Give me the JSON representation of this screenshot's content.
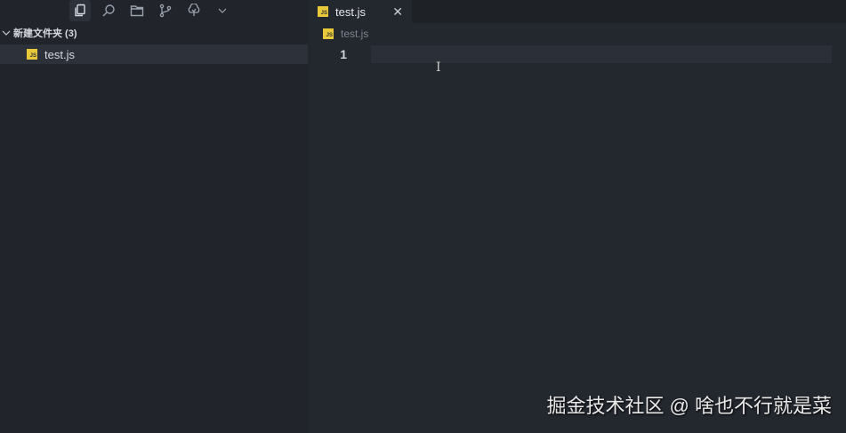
{
  "activity_bar": {
    "items": [
      "explorer-icon",
      "search-icon",
      "folder-icon",
      "source-control-icon",
      "tree-icon",
      "chevron-down-icon"
    ]
  },
  "explorer": {
    "folder": "新建文件夹 (3)",
    "files": [
      {
        "name": "test.js",
        "icon": "JS"
      }
    ]
  },
  "editor": {
    "tab": {
      "label": "test.js",
      "icon": "JS",
      "close": "✕"
    },
    "breadcrumb": "test.js",
    "lines": [
      "1"
    ]
  },
  "watermark": "掘金技术社区 @ 啥也不行就是菜",
  "colors": {
    "sidebar": "#21252b",
    "editor": "#23272e",
    "js": "#e8c93a"
  }
}
